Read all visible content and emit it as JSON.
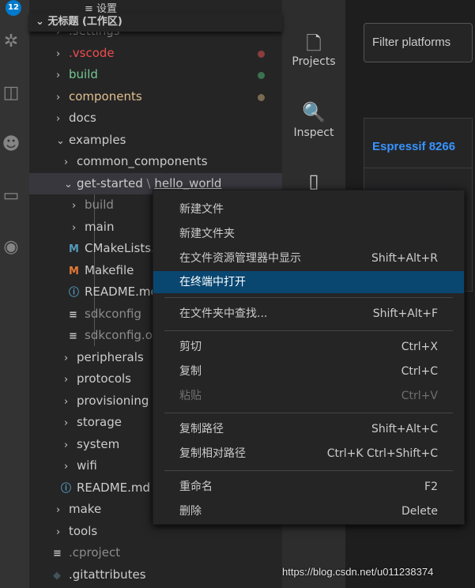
{
  "activity_bar": {
    "badge": "12",
    "icons": [
      "source-control-icon",
      "debug-icon",
      "extensions-icon",
      "platformio-icon",
      "remote-explorer-icon",
      "espressif-icon"
    ]
  },
  "explorer": {
    "top_item": "设置",
    "workspace_title": "无标题 (工作区)",
    "rows": [
      {
        "label": ".settings",
        "indent": 1,
        "kind": "folder",
        "color": "#8a8a8a"
      },
      {
        "label": ".vscode",
        "indent": 1,
        "kind": "folder",
        "color": "#f14c4c",
        "dot": "#8b3d3d"
      },
      {
        "label": "build",
        "indent": 1,
        "kind": "folder",
        "color": "#73c991",
        "dot": "#3a7250"
      },
      {
        "label": "components",
        "indent": 1,
        "kind": "folder",
        "color": "#e2c08d",
        "dot": "#7a6a50"
      },
      {
        "label": "docs",
        "indent": 1,
        "kind": "folder",
        "color": "#cccccc"
      },
      {
        "label": "examples",
        "indent": 1,
        "kind": "folder-open",
        "color": "#cccccc"
      },
      {
        "label": "common_components",
        "indent": 2,
        "kind": "folder",
        "color": "#cccccc"
      },
      {
        "label": "get-started",
        "label2": "hello_world",
        "indent": 2,
        "kind": "folder-open",
        "color": "#cccccc",
        "selected": true
      },
      {
        "label": "build",
        "indent": 3,
        "kind": "folder",
        "color": "#8c8c8c"
      },
      {
        "label": "main",
        "indent": 3,
        "kind": "folder",
        "color": "#cccccc"
      },
      {
        "label": "CMakeLists.txt",
        "indent": 3,
        "kind": "cmake",
        "color": "#cccccc"
      },
      {
        "label": "Makefile",
        "indent": 3,
        "kind": "make",
        "color": "#cccccc"
      },
      {
        "label": "README.md",
        "indent": 3,
        "kind": "info",
        "color": "#cccccc"
      },
      {
        "label": "sdkconfig",
        "indent": 3,
        "kind": "lines",
        "color": "#8c8c8c"
      },
      {
        "label": "sdkconfig.old",
        "indent": 3,
        "kind": "lines",
        "color": "#8c8c8c"
      },
      {
        "label": "peripherals",
        "indent": 2,
        "kind": "folder",
        "color": "#cccccc"
      },
      {
        "label": "protocols",
        "indent": 2,
        "kind": "folder",
        "color": "#cccccc"
      },
      {
        "label": "provisioning",
        "indent": 2,
        "kind": "folder",
        "color": "#cccccc"
      },
      {
        "label": "storage",
        "indent": 2,
        "kind": "folder",
        "color": "#cccccc"
      },
      {
        "label": "system",
        "indent": 2,
        "kind": "folder",
        "color": "#cccccc"
      },
      {
        "label": "wifi",
        "indent": 2,
        "kind": "folder",
        "color": "#cccccc"
      },
      {
        "label": "README.md",
        "indent": 2,
        "kind": "info",
        "color": "#cccccc"
      },
      {
        "label": "make",
        "indent": 1,
        "kind": "folder",
        "color": "#cccccc"
      },
      {
        "label": "tools",
        "indent": 1,
        "kind": "folder",
        "color": "#cccccc"
      },
      {
        "label": ".cproject",
        "indent": 1,
        "kind": "lines",
        "color": "#8c8c8c"
      },
      {
        "label": ".gitattributes",
        "indent": 1,
        "kind": "git",
        "color": "#cccccc"
      }
    ]
  },
  "platformio": {
    "projects": "Projects",
    "inspect": "Inspect"
  },
  "editor": {
    "filter_placeholder": "Filter platforms",
    "card_title": "Espressif 8266"
  },
  "context_menu": {
    "groups": [
      [
        {
          "label": "新建文件",
          "shortcut": ""
        },
        {
          "label": "新建文件夹",
          "shortcut": ""
        },
        {
          "label": "在文件资源管理器中显示",
          "shortcut": "Shift+Alt+R"
        },
        {
          "label": "在终端中打开",
          "shortcut": "",
          "highlighted": true
        }
      ],
      [
        {
          "label": "在文件夹中查找...",
          "shortcut": "Shift+Alt+F"
        }
      ],
      [
        {
          "label": "剪切",
          "shortcut": "Ctrl+X"
        },
        {
          "label": "复制",
          "shortcut": "Ctrl+C"
        },
        {
          "label": "粘贴",
          "shortcut": "Ctrl+V",
          "disabled": true
        }
      ],
      [
        {
          "label": "复制路径",
          "shortcut": "Shift+Alt+C"
        },
        {
          "label": "复制相对路径",
          "shortcut": "Ctrl+K Ctrl+Shift+C"
        }
      ],
      [
        {
          "label": "重命名",
          "shortcut": "F2"
        },
        {
          "label": "删除",
          "shortcut": "Delete"
        }
      ]
    ]
  },
  "watermark": "https://blog.csdn.net/u011238374"
}
